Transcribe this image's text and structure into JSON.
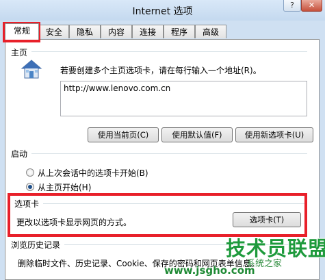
{
  "window": {
    "title": "Internet 选项",
    "help_label": "?",
    "close_label": "✕"
  },
  "tabs": [
    {
      "label": "常规"
    },
    {
      "label": "安全"
    },
    {
      "label": "隐私"
    },
    {
      "label": "内容"
    },
    {
      "label": "连接"
    },
    {
      "label": "程序"
    },
    {
      "label": "高级"
    }
  ],
  "home_page": {
    "group_label": "主页",
    "instruction": "若要创建多个主页选项卡，请在每行输入一个地址(R)。",
    "url_value": "http://www.lenovo.com.cn",
    "buttons": {
      "use_current": "使用当前页(C)",
      "use_default": "使用默认值(F)",
      "use_new_tab": "使用新选项卡(U)"
    }
  },
  "startup": {
    "group_label": "启动",
    "options": [
      {
        "label": "从上次会话中的选项卡开始(B)",
        "checked": false
      },
      {
        "label": "从主页开始(H)",
        "checked": true
      }
    ]
  },
  "tabs_section": {
    "group_label": "选项卡",
    "description": "更改以选项卡显示网页的方式。",
    "button": "选项卡(T)"
  },
  "history": {
    "group_label": "浏览历史记录",
    "description": "删除临时文件、历史记录、Cookie、保存的密码和网页表单信息。"
  },
  "watermark": {
    "main": "技术员联盟",
    "sub": "系统之家",
    "url": "www.jsgho.com"
  },
  "colors": {
    "highlight_box": "#e8202a",
    "watermark": "#1e9a3c"
  },
  "icons": {
    "home": "house-icon"
  }
}
